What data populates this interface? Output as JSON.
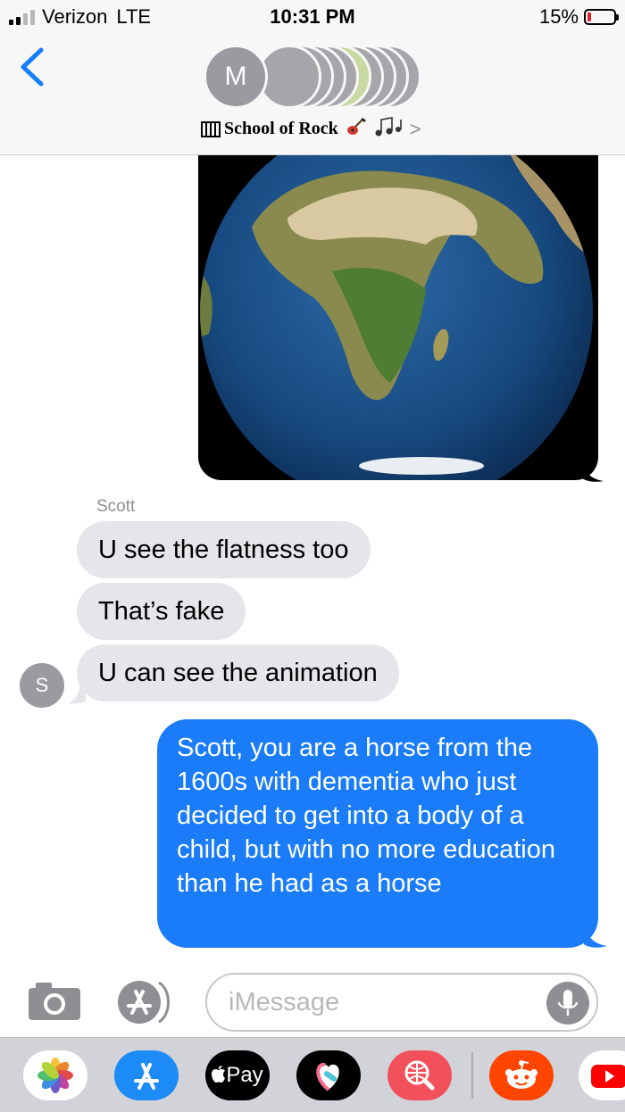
{
  "status_bar": {
    "carrier": "Verizon",
    "network": "LTE",
    "time": "10:31 PM",
    "battery_percent": "15%",
    "battery_level": 0.15,
    "battery_color": "#e4202a"
  },
  "header": {
    "avatar_initial": "M",
    "group_name": "School of Rock",
    "group_name_emoji": [
      "piano",
      "guitar",
      "musical-notes"
    ],
    "chevron": ">"
  },
  "conversation": {
    "image_attachment": "earth-globe-image",
    "incoming": {
      "sender_name": "Scott",
      "sender_initial": "S",
      "messages": [
        "U see the flatness too",
        "That’s fake",
        "U can see the animation"
      ]
    },
    "outgoing": {
      "text": "Scott, you are a horse from the 1600s with dementia who just decided to get into a body of a child, but with no more education than he had as a horse"
    }
  },
  "composer": {
    "placeholder": "iMessage"
  },
  "app_drawer": {
    "apps": [
      "photos-app-icon",
      "app-store-icon",
      "apple-pay-icon",
      "digital-touch-icon",
      "web-images-icon",
      "reddit-icon",
      "youtube-icon"
    ],
    "apple_pay_label": "Pay"
  },
  "colors": {
    "incoming_bubble": "#e5e5ea",
    "outgoing_bubble": "#1a7cf9",
    "ios_blue": "#147efb"
  }
}
